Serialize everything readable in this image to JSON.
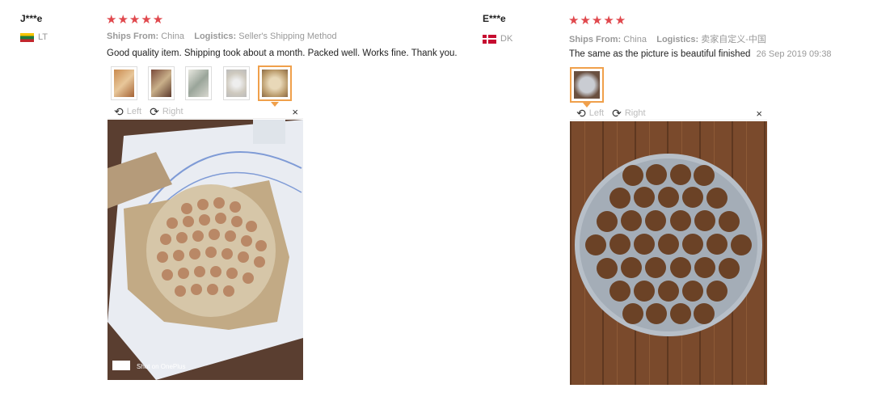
{
  "review1": {
    "user": "J***e",
    "country": "LT",
    "stars": "★★★★★",
    "ships_label": "Ships From:",
    "ships_value": "China",
    "logistics_label": "Logistics:",
    "logistics_value": "Seller's Shipping Method",
    "text": "Good quality item. Shipping took about a month. Packed well. Works fine. Thank you.",
    "viewer": {
      "left": "Left",
      "right": "Right",
      "close": "×"
    },
    "photo_caption": "Shot on OnePlus"
  },
  "review2": {
    "user": "E***e",
    "country": "DK",
    "stars": "★★★★★",
    "ships_label": "Ships From:",
    "ships_value": "China",
    "logistics_label": "Logistics:",
    "logistics_value": "卖家自定义-中国",
    "text": "The same as the picture is beautiful finished",
    "date": "26 Sep 2019 09:38",
    "viewer": {
      "left": "Left",
      "right": "Right",
      "close": "×"
    }
  },
  "colors": {
    "star": "#e0484d",
    "accent": "#f0a04b"
  }
}
